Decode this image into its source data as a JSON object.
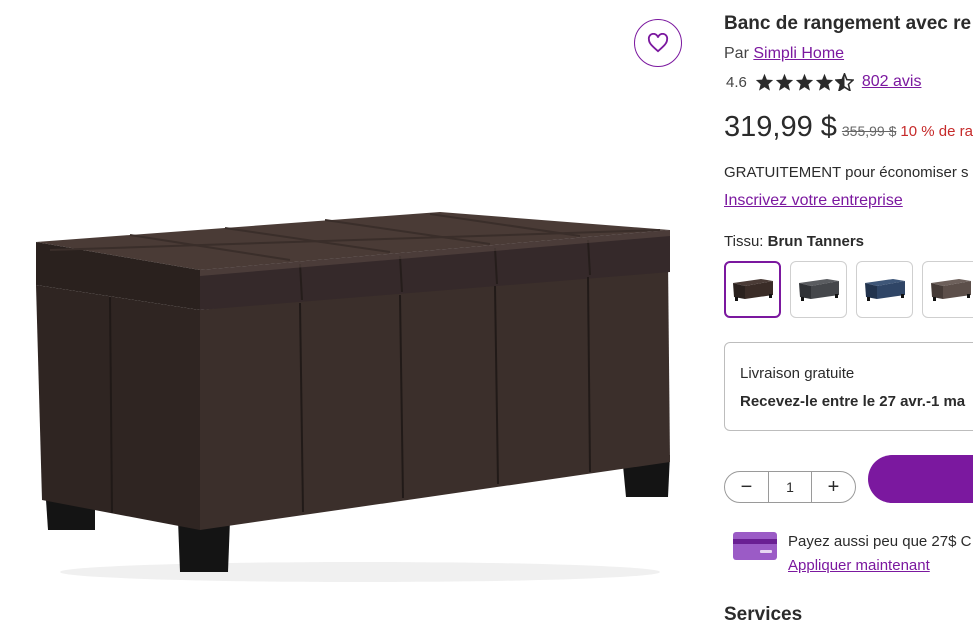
{
  "product": {
    "title": "Banc de rangement avec re",
    "by_label": "Par",
    "brand": "Simpli Home",
    "rating_value": "4.6",
    "rating_stars": 4.6,
    "reviews_link": "802 avis",
    "price": "319,99 $",
    "old_price": "355,99 $",
    "discount": "10 % de ra"
  },
  "business": {
    "free_text": "GRATUITEMENT pour économiser s",
    "signup_link": "Inscrivez votre entreprise"
  },
  "fabric": {
    "label": "Tissu:",
    "selected": "Brun Tanners",
    "swatches": [
      {
        "color": "#3a2c27"
      },
      {
        "color": "#45474b"
      },
      {
        "color": "#2f4566"
      },
      {
        "color": "#5c4f4a"
      }
    ]
  },
  "shipping": {
    "title": "Livraison gratuite",
    "date": "Recevez-le entre le 27 avr.-1 ma"
  },
  "quantity": {
    "value": "1",
    "minus": "−",
    "plus": "+"
  },
  "payment": {
    "text": "Payez aussi peu que 27$ C",
    "apply_link": "Appliquer maintenant"
  },
  "sections": {
    "services": "Services"
  },
  "colors": {
    "accent": "#7b189f",
    "discount": "#c62a2a"
  },
  "icons": {
    "favorite": "heart-icon",
    "card": "credit-card-icon",
    "star": "star-icon"
  }
}
